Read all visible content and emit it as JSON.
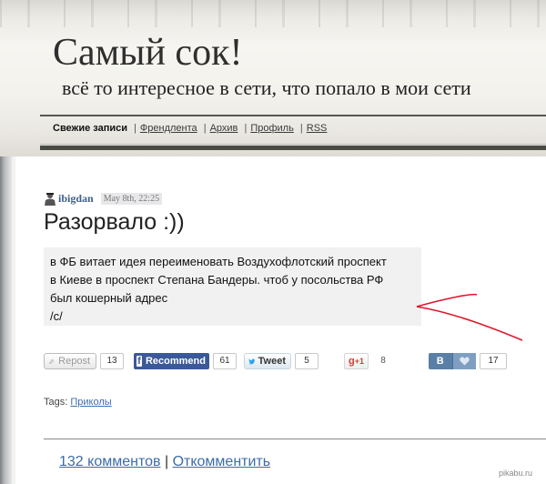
{
  "site": {
    "title": "Самый сок!",
    "subtitle": "всё то интересное в сети, что попало в мои сети"
  },
  "nav": {
    "current": "Свежие записи",
    "links": [
      "Френдлента",
      "Архив",
      "Профиль",
      "RSS"
    ],
    "separator": "|"
  },
  "post": {
    "author": "ibigdan",
    "date": "May 8th, 22:25",
    "title": "Разорвало :))",
    "lines": [
      "в ФБ витает идея переименовать Воздухофлотский проспект",
      "в Киеве в проспект Степана Бандеры. чтоб у посольства РФ",
      "был кошерный адрес",
      "/c/"
    ]
  },
  "share": {
    "repost": {
      "label": "Repost",
      "count": "13"
    },
    "facebook": {
      "label": "Recommend",
      "icon": "f",
      "count": "61"
    },
    "twitter": {
      "label": "Tweet",
      "count": "5"
    },
    "gplus": {
      "label": "+1",
      "icon": "g",
      "count": "8"
    },
    "vk": {
      "icon": "B",
      "count": "17"
    }
  },
  "tags": {
    "label": "Tags:",
    "items": [
      "Приколы"
    ]
  },
  "footer": {
    "comments": "132 комментов",
    "separator": "|",
    "reply": "Откомментить"
  },
  "watermark": "pikabu.ru",
  "colors": {
    "link": "#3c5f8a",
    "facebook": "#3b5998",
    "vk": "#5a7fa6",
    "arrow": "#e0162b"
  }
}
